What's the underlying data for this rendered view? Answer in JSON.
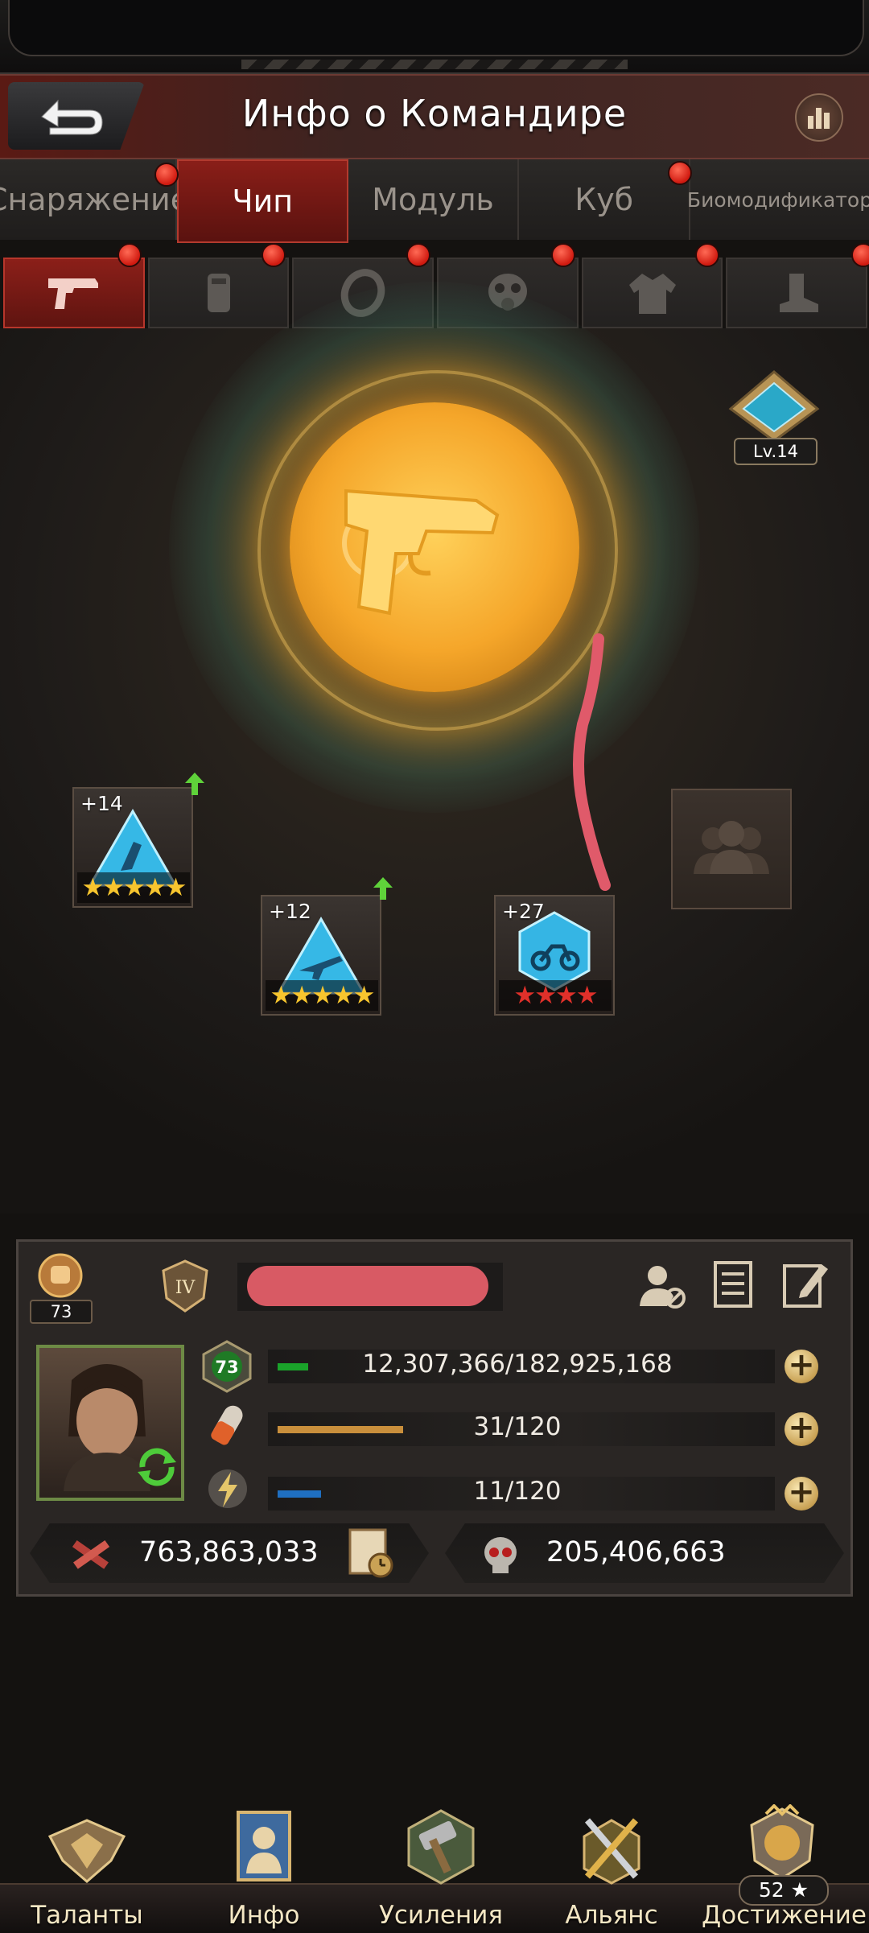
{
  "header": {
    "title": "Инфо о Командире"
  },
  "category_tabs": [
    {
      "label": "Снаряжение",
      "active": false,
      "badge": false
    },
    {
      "label": "Чип",
      "active": true,
      "badge": true
    },
    {
      "label": "Модуль",
      "active": false,
      "badge": false
    },
    {
      "label": "Куб",
      "active": false,
      "badge": false
    },
    {
      "label": "Биомодификатор",
      "active": false,
      "badge": true
    }
  ],
  "slot_tabs": [
    {
      "icon": "pistol-icon",
      "active": true,
      "badge": true
    },
    {
      "icon": "armor-plate-icon",
      "active": false,
      "badge": true
    },
    {
      "icon": "ring-icon",
      "active": false,
      "badge": true
    },
    {
      "icon": "gas-mask-icon",
      "active": false,
      "badge": true
    },
    {
      "icon": "jacket-icon",
      "active": false,
      "badge": true
    },
    {
      "icon": "boot-icon",
      "active": false,
      "badge": true
    }
  ],
  "main": {
    "core_icon": "pistol-icon",
    "level_badge": "Lv.14",
    "chips": [
      {
        "level": "+14",
        "stars": "★★★★★",
        "star_color": "#f7c52e",
        "upgrade": true,
        "icon": "triangle-chip-icon"
      },
      {
        "level": "+12",
        "stars": "★★★★★",
        "star_color": "#f7c52e",
        "upgrade": true,
        "icon": "triangle-chip-rifle-icon"
      },
      {
        "level": "+27",
        "stars": "★★★★",
        "star_color": "#e0302a",
        "upgrade": false,
        "icon": "hexagon-chip-motorcycle-icon"
      }
    ],
    "locked_slot_icon": "group-icon"
  },
  "profile": {
    "power_badge_value": "73",
    "rank_badge": "IV",
    "level": "73",
    "exp": "12,307,366/182,925,168",
    "stamina": "31/120",
    "energy": "11/120",
    "power": "763,863,033",
    "kills": "205,406,663",
    "colors": {
      "exp_bar": "#1aa32a",
      "stamina_bar": "#c98f3c",
      "energy_bar": "#1f6fc1"
    }
  },
  "bottom_nav": [
    {
      "label": "Таланты",
      "icon": "wings-emblem-icon"
    },
    {
      "label": "Инфо",
      "icon": "commander-card-icon"
    },
    {
      "label": "Усиления",
      "icon": "hammer-icon"
    },
    {
      "label": "Альянс",
      "icon": "crossed-swords-icon"
    },
    {
      "label": "Достижение",
      "icon": "lion-crest-icon",
      "badge": "52 ★"
    }
  ]
}
